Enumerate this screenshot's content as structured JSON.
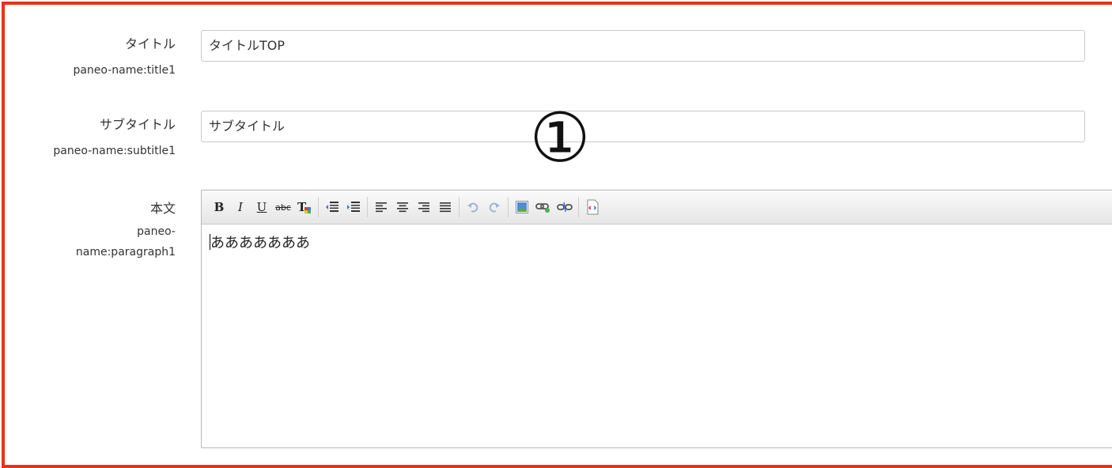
{
  "fields": {
    "title": {
      "label": "タイトル",
      "sublabel": "paneo-name:title1",
      "value": "タイトルTOP"
    },
    "subtitle": {
      "label": "サブタイトル",
      "sublabel": "paneo-name:subtitle1",
      "value": "サブタイトル"
    },
    "body": {
      "label": "本文",
      "sublabel_line1": "paneo-",
      "sublabel_line2": "name:paragraph1",
      "content": "あああああああ"
    }
  },
  "annotation": {
    "marker": "①"
  },
  "toolbar": {
    "bold": "B",
    "italic": "I",
    "underline": "U",
    "strike": "abc",
    "format": "T"
  },
  "colors": {
    "frame": "#e8321e",
    "border": "#c9c9c9",
    "toolbar_bg": "#e6e6e6"
  },
  "icons": [
    "bold-icon",
    "italic-icon",
    "underline-icon",
    "strikethrough-icon",
    "remove-format-icon",
    "outdent-icon",
    "indent-icon",
    "align-left-icon",
    "align-center-icon",
    "align-right-icon",
    "align-justify-icon",
    "undo-icon",
    "redo-icon",
    "image-icon",
    "link-icon",
    "unlink-icon",
    "source-code-icon"
  ]
}
